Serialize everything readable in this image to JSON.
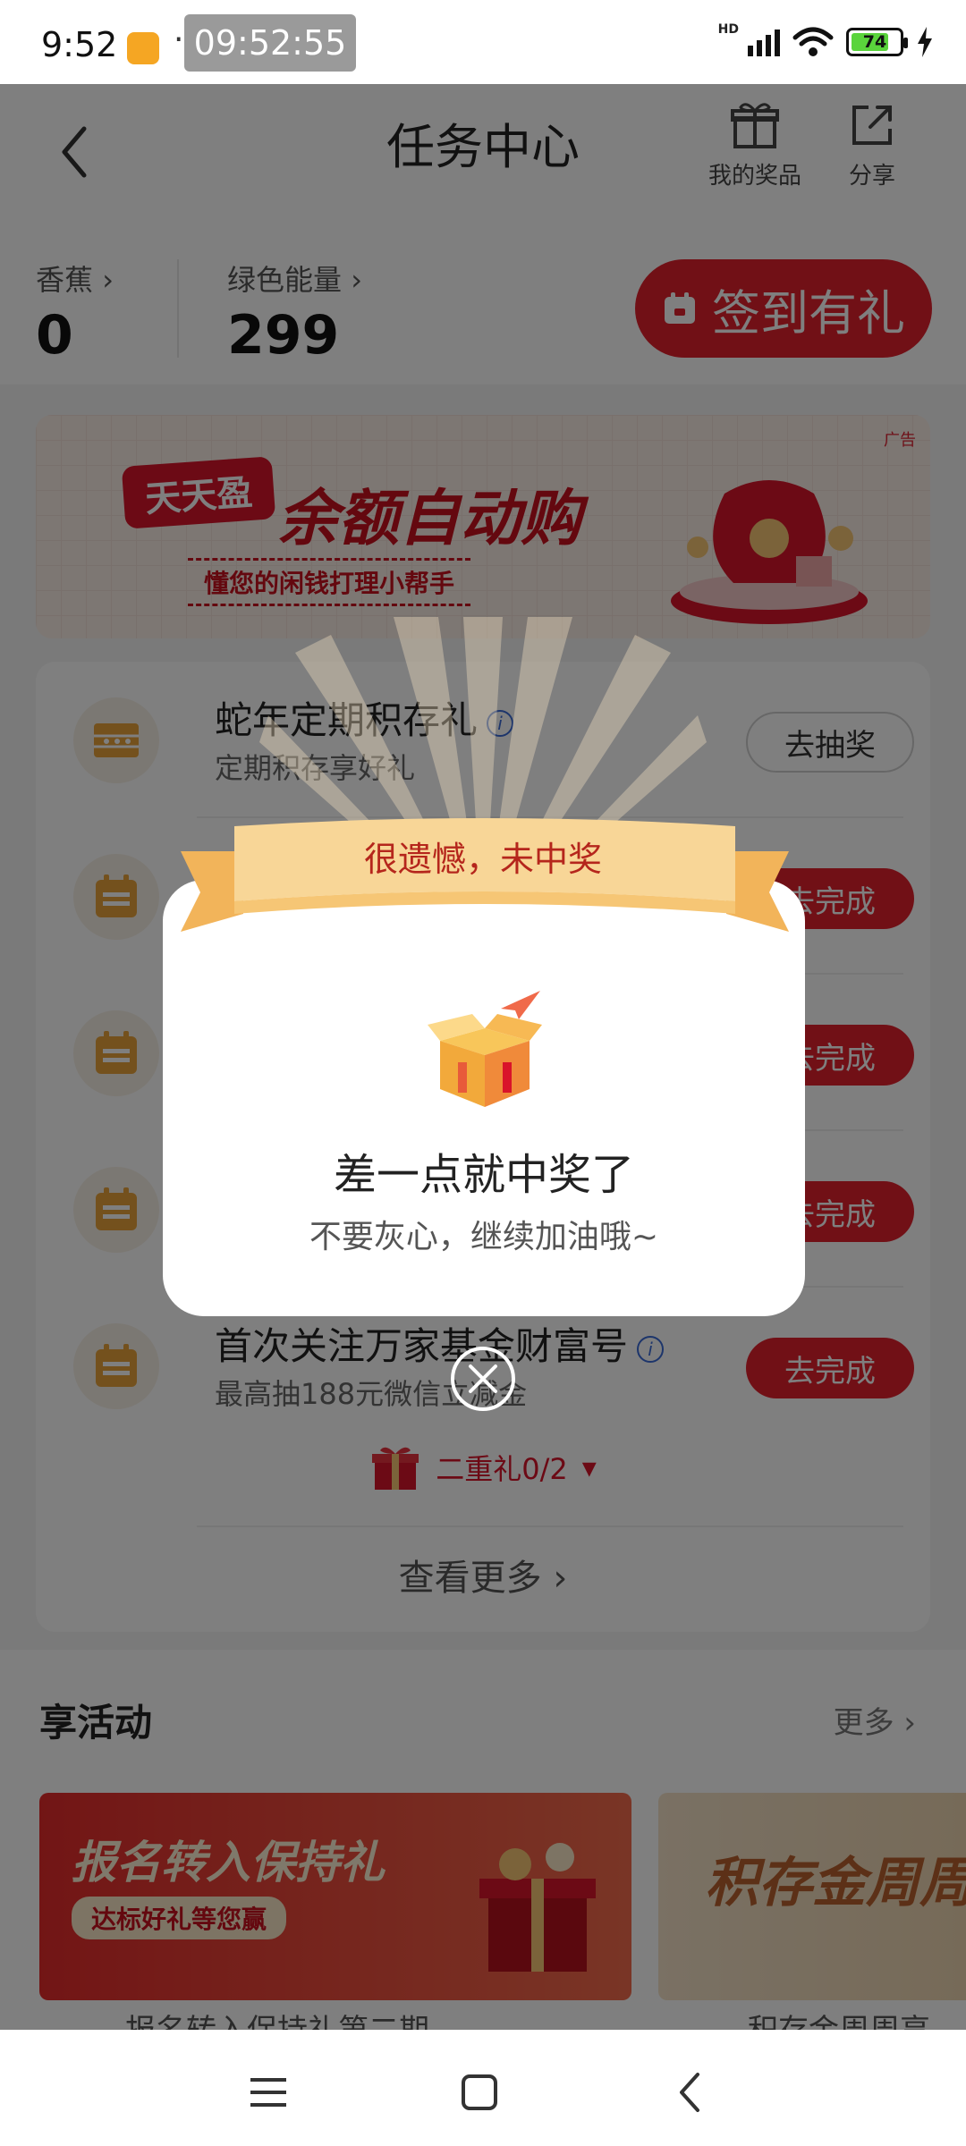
{
  "status_bar": {
    "time": "9:52",
    "dots": "··",
    "clock_overlay": "09:52:55",
    "battery": "74",
    "network": "HD"
  },
  "header": {
    "title": "任务中心",
    "my_prizes": "我的奖品",
    "share": "分享"
  },
  "points": {
    "banana_label": "香蕉",
    "banana_value": "0",
    "energy_label": "绿色能量",
    "energy_value": "299",
    "signin_label": "签到有礼"
  },
  "banner": {
    "ad_tag": "广告",
    "brand": "天天盈",
    "title": "余额自动购",
    "subtitle": "懂您的闲钱打理小帮手"
  },
  "tasks": {
    "items": [
      {
        "title": "蛇年定期积存礼",
        "subtitle": "定期积存享好礼",
        "button": "去抽奖",
        "info": "i",
        "icon": "abacus-icon"
      },
      {
        "button": "去完成",
        "icon": "calendar-icon"
      },
      {
        "button": "去完成",
        "icon": "calendar-icon"
      },
      {
        "button": "去完成",
        "icon": "calendar-icon"
      },
      {
        "title": "首次关注万家基金财富号",
        "subtitle": "最高抽188元微信立减金",
        "button": "去完成",
        "info": "i",
        "icon": "calendar-icon"
      }
    ],
    "second_gift": "二重礼0/2",
    "see_more": "查看更多"
  },
  "activities": {
    "title": "享活动",
    "more": "更多",
    "cards": [
      {
        "title": "报名转入保持礼",
        "tag": "达标好礼等您赢",
        "caption": "报名转入保持礼第二期"
      },
      {
        "title": "积存金周周",
        "caption": "积存金周周享"
      }
    ]
  },
  "dialog": {
    "ribbon": "很遗憾，未中奖",
    "title": "差一点就中奖了",
    "subtitle": "不要灰心，继续加油哦~"
  },
  "colors": {
    "brand_red": "#e2212d",
    "ribbon_gold": "#f6c675",
    "overlay": "rgba(0,0,0,0.5)"
  }
}
